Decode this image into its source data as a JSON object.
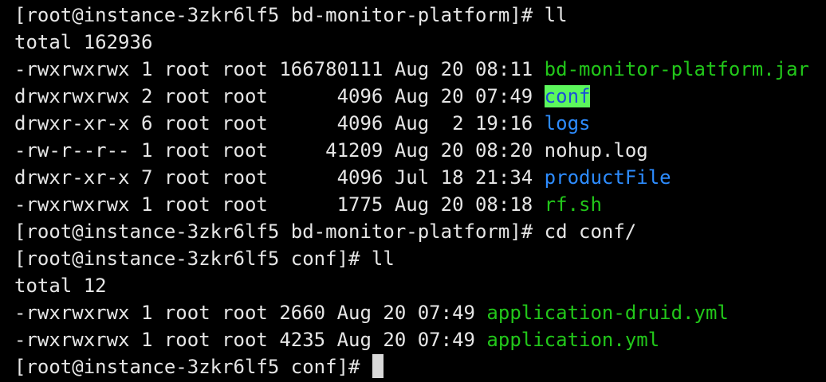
{
  "colors": {
    "background": "#000000",
    "text": "#e6e6e6",
    "executable": "#22c71a",
    "directory": "#2d8cff",
    "highlight_bg": "#5cf75c",
    "highlight_fg": "#1a4fd6",
    "cursor": "#d9d9d9"
  },
  "lines": [
    {
      "name": "prompt-line",
      "segments": [
        {
          "text": "[root@instance-3zkr6lf5 bd-monitor-platform]# ll"
        }
      ]
    },
    {
      "name": "total-line",
      "segments": [
        {
          "text": "total 162936"
        }
      ]
    },
    {
      "name": "file-row",
      "segments": [
        {
          "text": "-rwxrwxrwx 1 root root 166780111 Aug 20 08:11 "
        },
        {
          "text": "bd-monitor-platform.jar",
          "kind": "executable"
        }
      ]
    },
    {
      "name": "file-row",
      "segments": [
        {
          "text": "drwxrwxrwx 2 root root      4096 Aug 20 07:49 "
        },
        {
          "text": "conf",
          "kind": "highlight"
        }
      ]
    },
    {
      "name": "file-row",
      "segments": [
        {
          "text": "drwxr-xr-x 6 root root      4096 Aug  2 19:16 "
        },
        {
          "text": "logs",
          "kind": "directory"
        }
      ]
    },
    {
      "name": "file-row",
      "segments": [
        {
          "text": "-rw-r--r-- 1 root root     41209 Aug 20 08:20 "
        },
        {
          "text": "nohup.log"
        }
      ]
    },
    {
      "name": "file-row",
      "segments": [
        {
          "text": "drwxr-xr-x 7 root root      4096 Jul 18 21:34 "
        },
        {
          "text": "productFile",
          "kind": "directory"
        }
      ]
    },
    {
      "name": "file-row",
      "segments": [
        {
          "text": "-rwxrwxrwx 1 root root      1775 Aug 20 08:18 "
        },
        {
          "text": "rf.sh",
          "kind": "executable"
        }
      ]
    },
    {
      "name": "prompt-line",
      "segments": [
        {
          "text": "[root@instance-3zkr6lf5 bd-monitor-platform]# cd conf/"
        }
      ]
    },
    {
      "name": "prompt-line",
      "segments": [
        {
          "text": "[root@instance-3zkr6lf5 conf]# ll"
        }
      ]
    },
    {
      "name": "total-line",
      "segments": [
        {
          "text": "total 12"
        }
      ]
    },
    {
      "name": "file-row",
      "segments": [
        {
          "text": "-rwxrwxrwx 1 root root 2660 Aug 20 07:49 "
        },
        {
          "text": "application-druid.yml",
          "kind": "executable"
        }
      ]
    },
    {
      "name": "file-row",
      "segments": [
        {
          "text": "-rwxrwxrwx 1 root root 4235 Aug 20 07:49 "
        },
        {
          "text": "application.yml",
          "kind": "executable"
        }
      ]
    },
    {
      "name": "active-prompt-line",
      "segments": [
        {
          "text": "[root@instance-3zkr6lf5 conf]# "
        }
      ],
      "cursor": true
    }
  ]
}
